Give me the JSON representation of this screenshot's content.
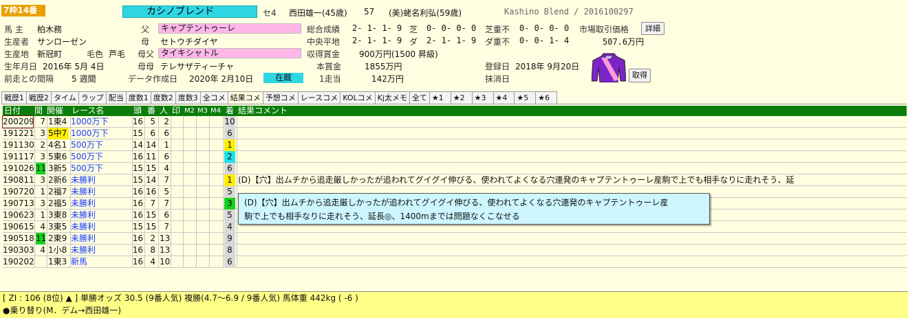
{
  "header": {
    "waku": "7枠14番",
    "horse_name": "カシノブレンド",
    "sex_age": "セ4",
    "jockey": "西田雄一(45歳)",
    "weight": "57",
    "trainer": "(美)蛯名利弘(59歳)",
    "english": "Kashino Blend / 2016100297"
  },
  "profile": {
    "owner_label": "馬 主",
    "owner": "柏木務",
    "breeder_label": "生産者",
    "breeder": "サンローゼン",
    "birthplace_label": "生産地",
    "birthplace": "新冠町",
    "coat_label": "毛色",
    "coat": "芦毛",
    "birthday_label": "生年月日",
    "birthday": "2016年 5月 4日",
    "interval_label": "前走との間隔",
    "interval": "5  週間",
    "sire_label": "父",
    "sire": "キャプテントゥーレ",
    "dam_label": "母",
    "dam": "セトウチダイヤ",
    "damsire_label": "母父",
    "damsire": "タイキシャトル",
    "granddam_label": "母母",
    "granddam": "テレサザティーチャ",
    "created_label": "データ作成日",
    "created": "2020年 2月10日",
    "status": "在厩",
    "total_label": "総合成績",
    "total": "2- 1- 1- 9",
    "turf_label": "芝",
    "turf": "0- 0- 0- 0",
    "turf_heavy_label": "芝重不",
    "turf_heavy": "0- 0- 0- 0",
    "market_label": "市場取引価格",
    "detail_button": "詳細",
    "central_label": "中央平地",
    "central": "2- 1- 1- 9",
    "dirt_label": "ダ",
    "dirt": "2- 1- 1- 9",
    "dirt_heavy_label": "ダ重不",
    "dirt_heavy": "0- 0- 1- 4",
    "market_price": "507.6万円",
    "prize_label": "収得賞金",
    "prize": "900万円(1500 昇級)",
    "main_prize_label": "本賞金",
    "main_prize": "1855万円",
    "per_race_label": "1走当",
    "per_race": "142万円",
    "reg_label": "登録日",
    "reg": "2018年 9月20日",
    "dereg_label": "抹消日",
    "fetch_button": "取得"
  },
  "tabs": [
    "戦歴1",
    "戦歴2",
    "タイム",
    "ラップ",
    "配当",
    "度数1",
    "度数2",
    "度数3",
    "全コメ",
    "結果コメ",
    "予想コメ",
    "レースコメ",
    "KOLコメ",
    "Kj太メモ",
    "全て",
    "★1",
    "★2",
    "★3",
    "★4",
    "★5",
    "★6"
  ],
  "active_tab": "結果コメ",
  "columns": [
    "日付",
    "間",
    "開催",
    "レース名",
    "頭",
    "番",
    "人",
    "印",
    "M2",
    "M3",
    "M4",
    "着",
    "結果コメント"
  ],
  "rows": [
    {
      "date": "200209",
      "int": "7",
      "kai": "1東4",
      "race": "1000万下",
      "tou": "16",
      "ban": "5",
      "nin": "2",
      "chaku": "10",
      "cmt": ""
    },
    {
      "date": "191221",
      "int": "3",
      "kai": "5中7",
      "race": "1000万下",
      "tou": "15",
      "ban": "6",
      "nin": "6",
      "chaku": "6",
      "cmt": ""
    },
    {
      "date": "191130",
      "int": "2",
      "kai": "4名1",
      "race": "500万下",
      "tou": "14",
      "ban": "14",
      "nin": "1",
      "chaku": "1",
      "cmt": ""
    },
    {
      "date": "191117",
      "int": "3",
      "kai": "5東6",
      "race": "500万下",
      "tou": "16",
      "ban": "11",
      "nin": "6",
      "chaku": "2",
      "cmt": ""
    },
    {
      "date": "191026",
      "int": "11",
      "kai": "3新5",
      "race": "500万下",
      "tou": "15",
      "ban": "15",
      "nin": "4",
      "chaku": "6",
      "cmt": ""
    },
    {
      "date": "190811",
      "int": "3",
      "kai": "2新6",
      "race": "未勝利",
      "tou": "15",
      "ban": "14",
      "nin": "7",
      "chaku": "1",
      "cmt": "(D)【穴】出ムチから追走厳しかったが追われてグイグイ伸びる、使われてよくなる穴連発のキャプテントゥーレ産駒で上でも相手なりに走れそう、延"
    },
    {
      "date": "190720",
      "int": "1",
      "kai": "2福7",
      "race": "未勝利",
      "tou": "16",
      "ban": "16",
      "nin": "5",
      "chaku": "5",
      "cmt": ""
    },
    {
      "date": "190713",
      "int": "3",
      "kai": "2福5",
      "race": "未勝利",
      "tou": "16",
      "ban": "7",
      "nin": "7",
      "chaku": "3",
      "cmt": ""
    },
    {
      "date": "190623",
      "int": "1",
      "kai": "3東8",
      "race": "未勝利",
      "tou": "16",
      "ban": "15",
      "nin": "6",
      "chaku": "5",
      "cmt": ""
    },
    {
      "date": "190615",
      "int": "4",
      "kai": "3東5",
      "race": "未勝利",
      "tou": "15",
      "ban": "15",
      "nin": "7",
      "chaku": "4",
      "cmt": ""
    },
    {
      "date": "190518",
      "int": "11",
      "kai": "2東9",
      "race": "未勝利",
      "tou": "16",
      "ban": "2",
      "nin": "13",
      "chaku": "9",
      "cmt": ""
    },
    {
      "date": "190303",
      "int": "4",
      "kai": "1小8",
      "race": "未勝利",
      "tou": "16",
      "ban": "8",
      "nin": "13",
      "chaku": "8",
      "cmt": ""
    },
    {
      "date": "190202",
      "int": "",
      "kai": "1東3",
      "race": "新馬",
      "tou": "16",
      "ban": "4",
      "nin": "10",
      "chaku": "6",
      "cmt": ""
    }
  ],
  "tooltip": {
    "line1": "(D)【穴】出ムチから追走厳しかったが追われてグイグイ伸びる、使われてよくなる穴連発のキャプテントゥーレ産",
    "line2": "駒で上でも相手なりに走れそう、延長◎、1400mまでは問題なくこなせる"
  },
  "footer": {
    "line1": "[ ZI : 106 (8位) ▲ ]  単勝オッズ  30.5 (9番人気)  複勝(4.7～6.9 / 9番人気)  馬体重 442kg ( -6 )",
    "line2": "●乗り替り(M．デム→西田雄一)"
  },
  "colors": {
    "accent_cyan": "#2ed6e4",
    "header_green": "#0a7d0a",
    "pink": "#ffb7ea",
    "waku": "#e8a000",
    "silks": "#7b24c8"
  }
}
